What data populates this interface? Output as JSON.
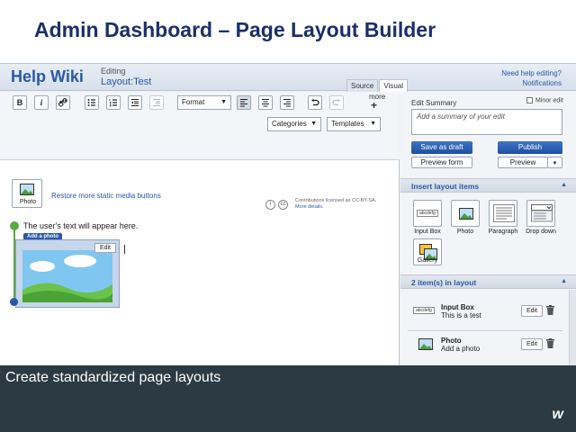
{
  "slide": {
    "title": "Admin Dashboard – Page Layout Builder",
    "caption": "Create standardized page layouts",
    "brand_mark": "w"
  },
  "app": {
    "logo": "Help Wiki",
    "editing_label": "Editing",
    "page_name": "Layout:Test",
    "view_tabs": [
      "Source",
      "Visual"
    ],
    "active_view": "Visual",
    "help_link": "Need help editing?",
    "notifications_link": "Notifications"
  },
  "toolbar": {
    "bold": "B",
    "italic": "i",
    "format_select": "Format",
    "more_label": "more",
    "more_plus": "+",
    "photo_button": "Photo",
    "restore_link": "Restore more static media buttons",
    "categories_select": "Categories",
    "templates_select": "Templates",
    "license_text": "Contributions licensed as CC-BY-SA.",
    "license_more": "More details."
  },
  "canvas": {
    "user_text": "The user's text will appear here.",
    "add_photo_tag": "Add a photo",
    "photo_edit": "Edit"
  },
  "side": {
    "edit_summary_label": "Edit Summary",
    "minor_edit_label": "Minor edit",
    "summary_placeholder": "Add a summary of your edit",
    "save_draft": "Save as draft",
    "publish": "Publish",
    "preview_form": "Preview form",
    "preview": "Preview",
    "insert_section": "Insert layout items",
    "tiles": [
      {
        "label": "Input Box",
        "mini": "abcdefg"
      },
      {
        "label": "Photo"
      },
      {
        "label": "Paragraph"
      },
      {
        "label": "Drop down"
      },
      {
        "label": "Gallery"
      }
    ],
    "layout_section": "2 item(s) in layout",
    "layout_items": [
      {
        "mini": "abcdefg",
        "title": "Input Box",
        "subtitle": "This is a test",
        "edit": "Edit"
      },
      {
        "title": "Photo",
        "subtitle": "Add a photo",
        "edit": "Edit"
      }
    ]
  },
  "colors": {
    "title_blue": "#1a2f6b",
    "link_blue": "#2a58a8",
    "button_blue": "#2a5fb3",
    "marker_green": "#5ca944",
    "caption_band": "#2b3a43"
  },
  "icons": [
    "bold-icon",
    "italic-icon",
    "link-icon",
    "bullet-list-icon",
    "numbered-list-icon",
    "outdent-icon",
    "indent-icon",
    "align-left-icon",
    "align-center-icon",
    "align-right-icon",
    "undo-icon",
    "redo-icon",
    "photo-icon",
    "trash-icon",
    "gallery-icon"
  ]
}
